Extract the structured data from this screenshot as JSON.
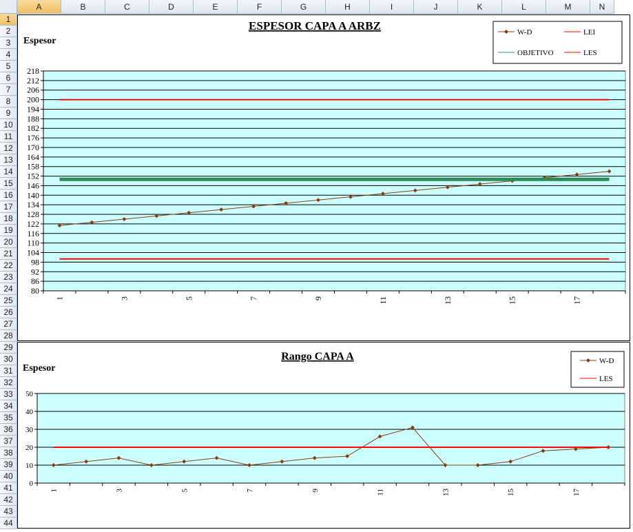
{
  "spreadsheet": {
    "columns": [
      "A",
      "B",
      "C",
      "D",
      "E",
      "F",
      "G",
      "H",
      "I",
      "J",
      "K",
      "L",
      "M",
      "N"
    ],
    "rows": [
      "1",
      "2",
      "3",
      "4",
      "5",
      "6",
      "7",
      "8",
      "9",
      "10",
      "11",
      "12",
      "13",
      "14",
      "15",
      "16",
      "17",
      "18",
      "19",
      "20",
      "21",
      "22",
      "23",
      "24",
      "25",
      "26",
      "27",
      "28",
      "29",
      "30",
      "31",
      "32",
      "33",
      "34",
      "35",
      "36",
      "37",
      "38",
      "39",
      "40",
      "41",
      "42",
      "43",
      "44"
    ],
    "selected_cell": "A1"
  },
  "chart_data": [
    {
      "type": "line",
      "title": "ESPESOR CAPA A ARBZ",
      "ylabel": "Espesor",
      "xlabel": "",
      "x": [
        1,
        2,
        3,
        4,
        5,
        6,
        7,
        8,
        9,
        10,
        11,
        12,
        13,
        14,
        15,
        16,
        17,
        18
      ],
      "x_tick_labels": [
        "1",
        "3",
        "5",
        "7",
        "9",
        "11",
        "13",
        "15",
        "17"
      ],
      "ylim": [
        80,
        218
      ],
      "y_ticks": [
        218,
        212,
        206,
        200,
        194,
        188,
        182,
        176,
        170,
        164,
        158,
        152,
        146,
        140,
        134,
        128,
        122,
        116,
        110,
        104,
        98,
        92,
        86,
        80
      ],
      "grid": true,
      "legend_position": "top-right",
      "series": [
        {
          "name": "W-D",
          "color": "#8b3a0f",
          "marker": "diamond",
          "values": [
            121,
            123,
            125,
            127,
            129,
            131,
            133,
            135,
            137,
            139,
            141,
            143,
            145,
            147,
            149,
            151,
            153,
            155
          ]
        },
        {
          "name": "LEI",
          "color": "#ff0000",
          "values": [
            100,
            100,
            100,
            100,
            100,
            100,
            100,
            100,
            100,
            100,
            100,
            100,
            100,
            100,
            100,
            100,
            100,
            100
          ]
        },
        {
          "name": "OBJETIVO",
          "color": "#2e8b57",
          "values": [
            150,
            150,
            150,
            150,
            150,
            150,
            150,
            150,
            150,
            150,
            150,
            150,
            150,
            150,
            150,
            150,
            150,
            150
          ]
        },
        {
          "name": "LES",
          "color": "#ff0000",
          "values": [
            200,
            200,
            200,
            200,
            200,
            200,
            200,
            200,
            200,
            200,
            200,
            200,
            200,
            200,
            200,
            200,
            200,
            200
          ]
        }
      ],
      "legend_order": [
        "W-D",
        "LEI",
        "OBJETIVO",
        "LES"
      ]
    },
    {
      "type": "line",
      "title": "Rango CAPA A",
      "ylabel": "Espesor",
      "xlabel": "",
      "x": [
        1,
        2,
        3,
        4,
        5,
        6,
        7,
        8,
        9,
        10,
        11,
        12,
        13,
        14,
        15,
        16,
        17,
        18
      ],
      "x_tick_labels": [
        "1",
        "3",
        "5",
        "7",
        "9",
        "11",
        "13",
        "15",
        "17"
      ],
      "ylim": [
        0,
        50
      ],
      "y_ticks": [
        50,
        40,
        30,
        20,
        10,
        0
      ],
      "grid": true,
      "legend_position": "top-right",
      "series": [
        {
          "name": "W-D",
          "color": "#8b3a0f",
          "marker": "diamond",
          "values": [
            10,
            12,
            14,
            10,
            12,
            14,
            10,
            12,
            14,
            15,
            26,
            31,
            10,
            10,
            12,
            18,
            19,
            20
          ]
        },
        {
          "name": "LES",
          "color": "#ff0000",
          "values": [
            20,
            20,
            20,
            20,
            20,
            20,
            20,
            20,
            20,
            20,
            20,
            20,
            20,
            20,
            20,
            20,
            20,
            20
          ]
        }
      ],
      "legend_order": [
        "W-D",
        "LES"
      ]
    }
  ]
}
